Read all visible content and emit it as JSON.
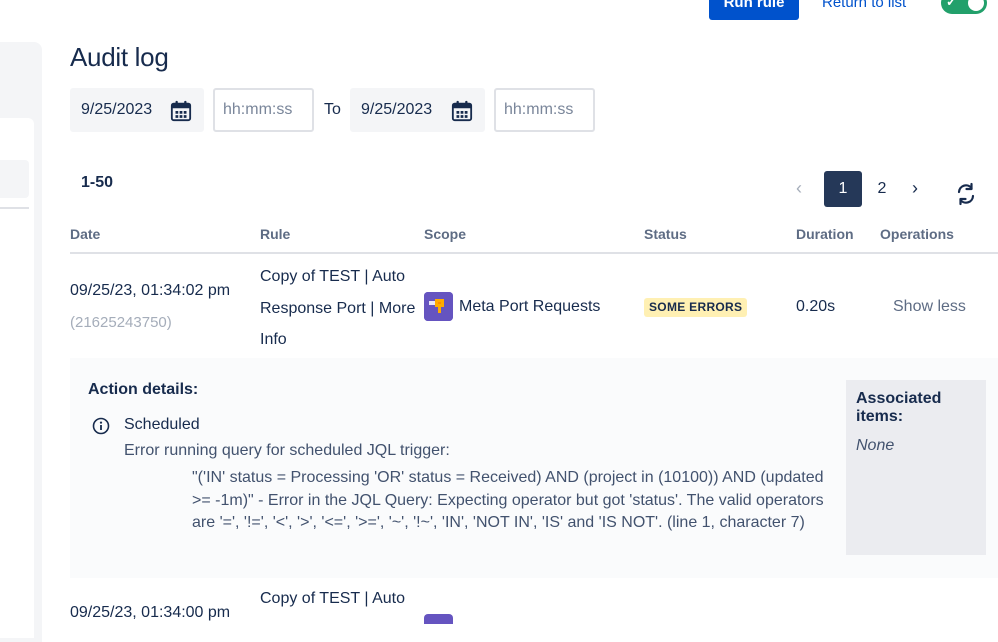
{
  "header": {
    "run_rule_label": "Run rule",
    "return_label": "Return to list",
    "toggle_state": "on"
  },
  "page": {
    "title": "Audit log"
  },
  "filters": {
    "from_date": "9/25/2023",
    "from_time_placeholder": "hh:mm:ss",
    "to_label": "To",
    "to_date": "9/25/2023",
    "to_time_placeholder": "hh:mm:ss"
  },
  "results": {
    "range": "1-50"
  },
  "pagination": {
    "prev": "‹",
    "pages": [
      "1",
      "2"
    ],
    "current": "1",
    "next": "›"
  },
  "table": {
    "columns": [
      "Date",
      "Rule",
      "Scope",
      "Status",
      "Duration",
      "Operations"
    ],
    "rows": [
      {
        "date": "09/25/23, 01:34:02 pm",
        "id": "(21625243750)",
        "rule": "Copy of TEST | Auto Response Port | More Info",
        "scope": "Meta Port Requests",
        "status": "SOME ERRORS",
        "duration": "0.20s",
        "operation": "Show less"
      },
      {
        "date": "09/25/23, 01:34:00 pm",
        "rule": "Copy of TEST | Auto"
      }
    ]
  },
  "details": {
    "action_title": "Action details:",
    "component": "Scheduled",
    "error_heading": "Error running query for scheduled JQL trigger:",
    "error_body": "\"('IN' status = Processing 'OR' status = Received) AND (project in (10100)) AND (updated >= -1m)\" - Error in the JQL Query: Expecting operator but got 'status'. The valid operators are '=', '!=', '<', '>', '<=', '>=', '~', '!~', 'IN', 'NOT IN', 'IS' and 'IS NOT'. (line 1, character 7)",
    "associated_title": "Associated items:",
    "associated_value": "None"
  },
  "colors": {
    "primary": "#0052CC",
    "text": "#172B4D",
    "badge_bg": "#FFF0B3",
    "toggle_on": "#22A06B",
    "scope_icon": "#6554C0",
    "active_page": "#253858"
  }
}
